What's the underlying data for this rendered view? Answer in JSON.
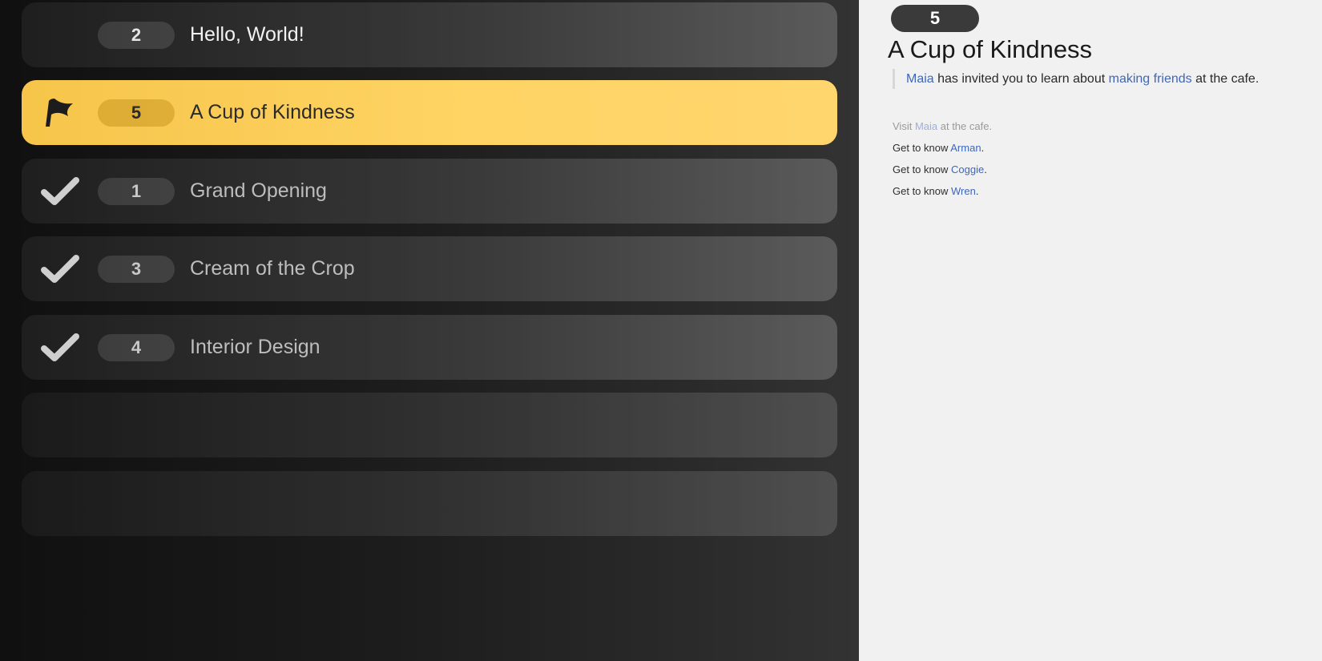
{
  "quest_list": {
    "rows": [
      {
        "status": "none",
        "status_icon": "",
        "number": "2",
        "title": "Hello, World!"
      },
      {
        "status": "active",
        "status_icon": "flag-icon",
        "number": "5",
        "title": "A Cup of Kindness"
      },
      {
        "status": "completed",
        "status_icon": "checkmark-icon",
        "number": "1",
        "title": "Grand Opening"
      },
      {
        "status": "completed",
        "status_icon": "checkmark-icon",
        "number": "3",
        "title": "Cream of the Crop"
      },
      {
        "status": "completed",
        "status_icon": "checkmark-icon",
        "number": "4",
        "title": "Interior Design"
      }
    ],
    "empty_slots": 2
  },
  "detail": {
    "number": "5",
    "title": "A Cup of Kindness",
    "description": {
      "person": "Maia",
      "text_1": " has invited you to learn about ",
      "topic": "making friends",
      "text_2": " at the cafe."
    },
    "objectives": [
      {
        "completed": true,
        "prefix": "Visit ",
        "name": "Maia",
        "suffix": " at the cafe."
      },
      {
        "completed": false,
        "prefix": "Get to know ",
        "name": "Arman",
        "suffix": "."
      },
      {
        "completed": false,
        "prefix": "Get to know ",
        "name": "Coggie",
        "suffix": "."
      },
      {
        "completed": false,
        "prefix": "Get to know ",
        "name": "Wren",
        "suffix": "."
      }
    ]
  },
  "colors": {
    "active_row": "#ffd464",
    "link": "#3f67b8",
    "panel_background": "#f1f1f1"
  }
}
